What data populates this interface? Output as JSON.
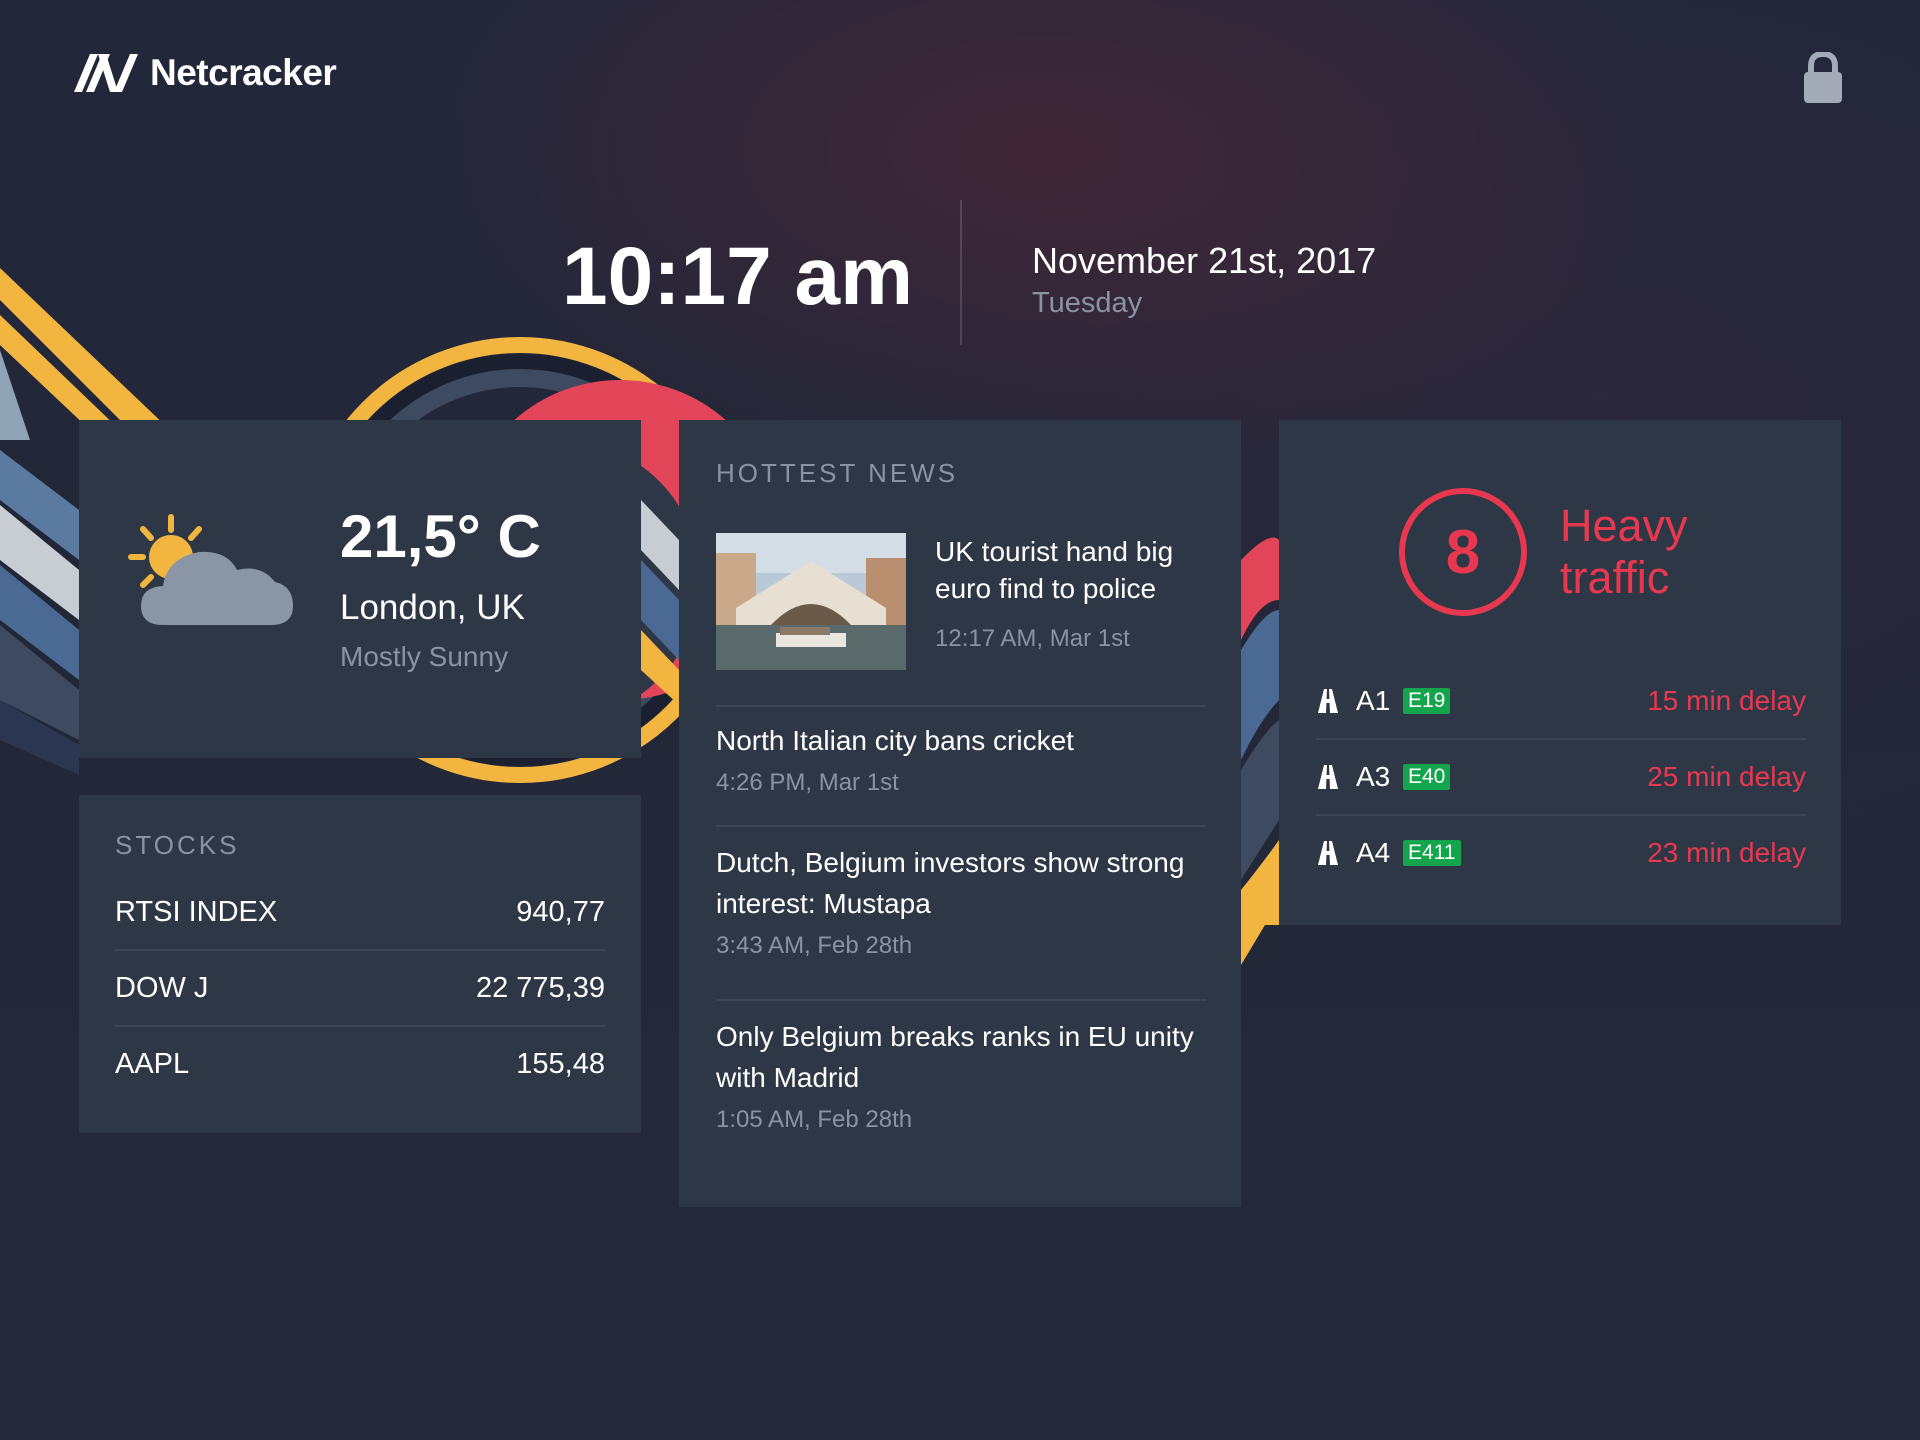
{
  "brand": {
    "name": "Netcracker"
  },
  "clock": {
    "time": "10:17 am",
    "date": "November 21st, 2017",
    "day": "Tuesday"
  },
  "weather": {
    "temperature": "21,5° C",
    "city": "London, UK",
    "condition": "Mostly Sunny",
    "icon": "partly-cloudy-icon"
  },
  "stocks": {
    "heading": "STOCKS",
    "items": [
      {
        "name": "RTSI INDEX",
        "value": "940,77"
      },
      {
        "name": "DOW J",
        "value": "22 775,39"
      },
      {
        "name": "AAPL",
        "value": "155,48"
      }
    ]
  },
  "news": {
    "heading": "HOTTEST NEWS",
    "items": [
      {
        "title": "UK tourist hand big euro find to police",
        "time": "12:17 AM, Mar 1st"
      },
      {
        "title": "North Italian city bans cricket",
        "time": "4:26 PM, Mar 1st"
      },
      {
        "title": "Dutch, Belgium investors show strong interest: Mustapa",
        "time": "3:43 AM, Feb 28th"
      },
      {
        "title": "Only Belgium breaks ranks in EU unity with Madrid",
        "time": "1:05 AM, Feb 28th"
      }
    ]
  },
  "traffic": {
    "level": "8",
    "status": "Heavy traffic",
    "roads": [
      {
        "name": "A1",
        "badge": "E19",
        "delay": "15 min delay"
      },
      {
        "name": "A3",
        "badge": "E40",
        "delay": "25 min delay"
      },
      {
        "name": "A4",
        "badge": "E411",
        "delay": "23 min delay"
      }
    ]
  },
  "colors": {
    "background": "#232839",
    "card": "#2d3746",
    "muted_text": "#8a93a3",
    "alert": "#e8384f",
    "badge_green": "#13a54b",
    "accent_yellow": "#f2b640"
  }
}
